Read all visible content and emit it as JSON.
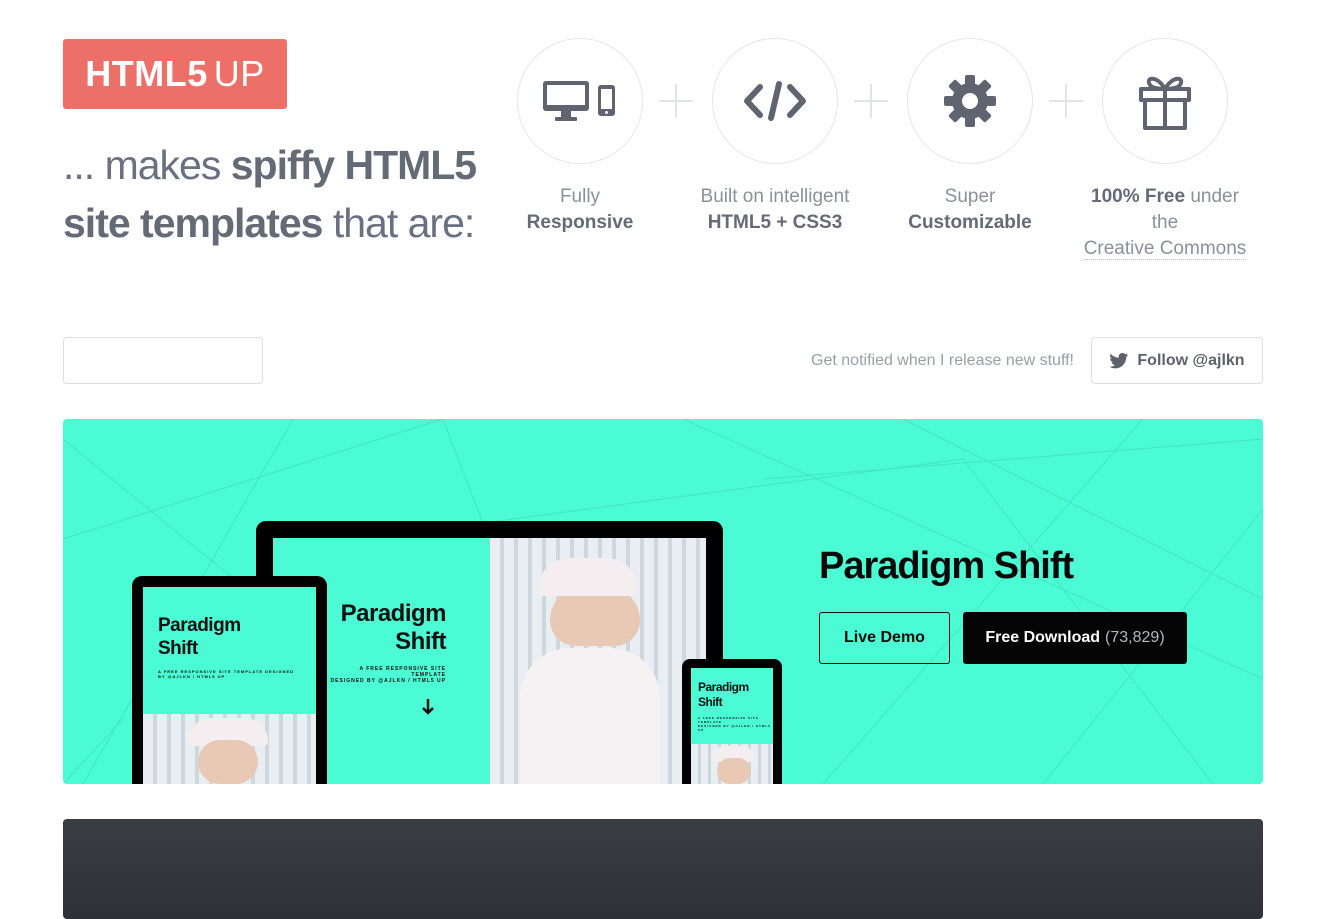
{
  "logo": {
    "bold": "HTML5",
    "light": "UP"
  },
  "tagline": {
    "part1": "... makes ",
    "bold1": "spiffy HTML5",
    "bold2": "site templates",
    "part2": " that are:"
  },
  "features": [
    {
      "icon": "desktop-mobile-icon",
      "line1": "Fully",
      "line2": "Responsive"
    },
    {
      "icon": "code-icon",
      "line1": "Built on intelligent",
      "line2": "HTML5 + CSS3"
    },
    {
      "icon": "gear-icon",
      "line1": "Super",
      "line2": "Customizable"
    },
    {
      "icon": "gift-icon",
      "bold": "100% Free",
      "rest": " under the",
      "line2": "Creative Commons"
    }
  ],
  "notify_text": "Get notified when I release new stuff!",
  "follow": {
    "icon": "twitter-icon",
    "label": "Follow @ajlkn"
  },
  "featured": {
    "title": "Paradigm Shift",
    "demo_label": "Live Demo",
    "download_label": "Free Download",
    "download_count": "(73,829)",
    "accent_color": "#4bfbd4",
    "mock": {
      "title_line1": "Paradigm",
      "title_line2": "Shift",
      "subtitle1": "A FREE RESPONSIVE SITE TEMPLATE DESIGNED",
      "subtitle2": "BY @AJLKN / HTML5 UP",
      "subtitle_desk1": "A FREE RESPONSIVE SITE TEMPLATE",
      "subtitle_desk2": "DESIGNED BY @AJLKN / HTML5 UP",
      "subtitle_phone": "A FREE RESPONSIVE SITE TEMPLATE",
      "subtitle_phone2": "DESIGNED BY @AJLKN / HTML5 UP"
    }
  },
  "colors": {
    "logo_bg": "#ec7068",
    "text": "#646a76",
    "dark_panel": "#33363d"
  }
}
